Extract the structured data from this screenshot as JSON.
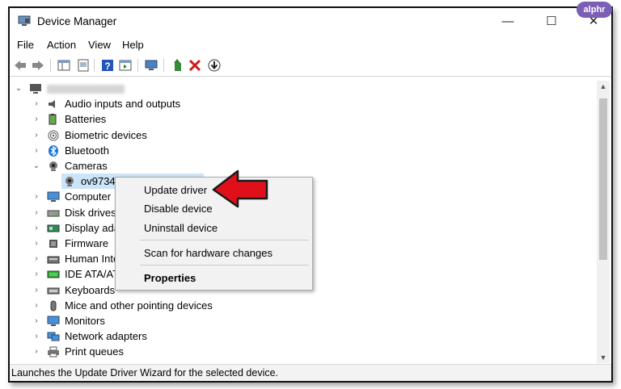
{
  "window": {
    "title": "Device Manager",
    "min": "—",
    "max": "☐",
    "close": "✕"
  },
  "menu": [
    "File",
    "Action",
    "View",
    "Help"
  ],
  "tree": {
    "root_label": "",
    "categories": [
      {
        "label": "Audio inputs and outputs",
        "icon": "speaker-icon"
      },
      {
        "label": "Batteries",
        "icon": "battery-icon"
      },
      {
        "label": "Biometric devices",
        "icon": "fingerprint-icon"
      },
      {
        "label": "Bluetooth",
        "icon": "bluetooth-icon"
      },
      {
        "label": "Cameras",
        "icon": "camera-icon"
      },
      {
        "label": "ov9734_",
        "icon": "webcam-icon"
      },
      {
        "label": "Computer",
        "icon": "monitor-icon"
      },
      {
        "label": "Disk drives",
        "icon": "disk-icon"
      },
      {
        "label": "Display ada",
        "icon": "display-adapter-icon"
      },
      {
        "label": "Firmware",
        "icon": "firmware-icon"
      },
      {
        "label": "Human Inte",
        "icon": "hid-icon"
      },
      {
        "label": "IDE ATA/ATA",
        "icon": "ide-icon"
      },
      {
        "label": "Keyboards",
        "icon": "keyboard-icon"
      },
      {
        "label": "Mice and other pointing devices",
        "icon": "mouse-icon"
      },
      {
        "label": "Monitors",
        "icon": "monitor-icon"
      },
      {
        "label": "Network adapters",
        "icon": "network-icon"
      },
      {
        "label": "Print queues",
        "icon": "printer-icon"
      }
    ]
  },
  "context_menu": {
    "update": "Update driver",
    "disable": "Disable device",
    "uninstall": "Uninstall device",
    "scan": "Scan for hardware changes",
    "properties": "Properties"
  },
  "statusbar": "Launches the Update Driver Wizard for the selected device.",
  "badge": "alphr",
  "colors": {
    "accent": "#1a74d8",
    "arrow": "#e0101a",
    "badge": "#7b5fb4"
  }
}
